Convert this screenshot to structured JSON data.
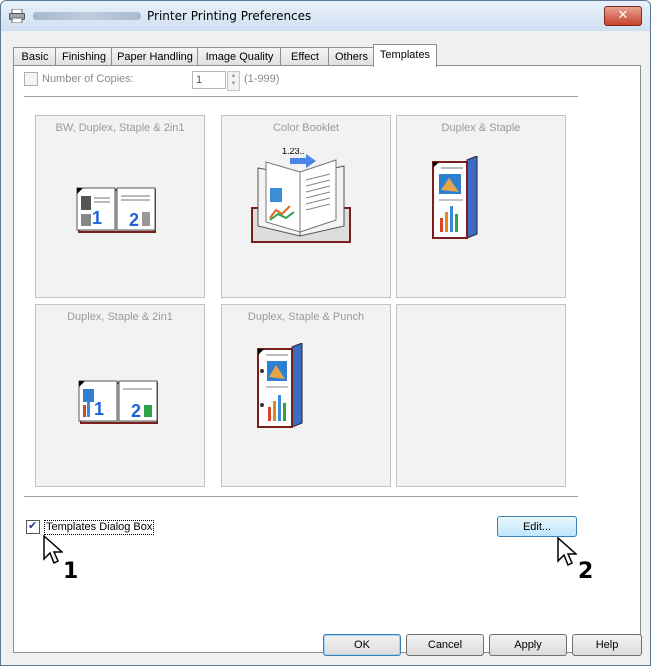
{
  "window": {
    "title": "Printer Printing Preferences",
    "close_label": "✕"
  },
  "tabs": [
    {
      "label": "Basic",
      "active": false
    },
    {
      "label": "Finishing",
      "active": false
    },
    {
      "label": "Paper Handling",
      "active": false
    },
    {
      "label": "Image Quality",
      "active": false
    },
    {
      "label": "Effect",
      "active": false
    },
    {
      "label": "Others",
      "active": false
    },
    {
      "label": "Templates",
      "active": true
    }
  ],
  "copies": {
    "label": "Number of Copies:",
    "value": "1",
    "range": "(1-999)",
    "checked": false
  },
  "templates": [
    {
      "label": "BW, Duplex, Staple & 2in1"
    },
    {
      "label": "Color Booklet",
      "badge": "1.23.."
    },
    {
      "label": "Duplex & Staple"
    },
    {
      "label": "Duplex, Staple & 2in1"
    },
    {
      "label": "Duplex, Staple & Punch"
    },
    {
      "label": ""
    }
  ],
  "dialog_checkbox": {
    "label": "Templates Dialog Box",
    "checked": true
  },
  "edit_button": "Edit...",
  "buttons": {
    "ok": "OK",
    "cancel": "Cancel",
    "apply": "Apply",
    "help": "Help"
  },
  "markers": {
    "one": "1",
    "two": "2"
  },
  "colors": {
    "accent": "#3c7fb1",
    "close": "#c7412a"
  }
}
